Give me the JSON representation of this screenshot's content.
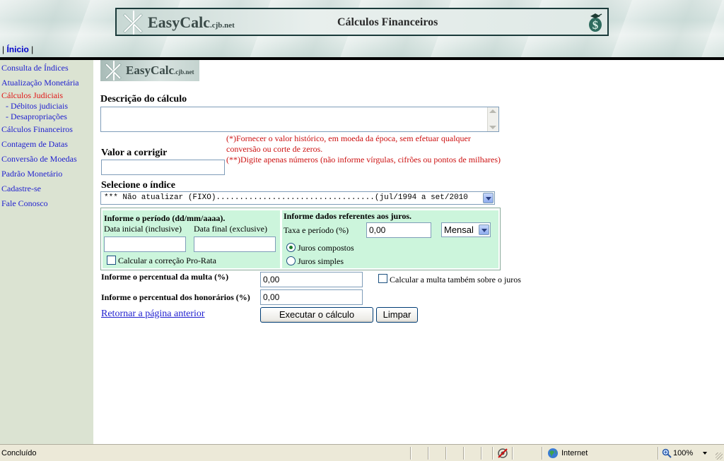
{
  "header": {
    "logo_main": "EasyCalc",
    "logo_domain": ".cjb.net",
    "title": "Cálculos Financeiros",
    "nav_open": "|",
    "nav_home": "Ínicio",
    "nav_close": "|"
  },
  "sidebar": {
    "items": [
      {
        "label": "Consulta de Índices",
        "active": false
      },
      {
        "label": "Atualização Monetária",
        "active": false
      },
      {
        "label": "Cálculos Judiciais",
        "active": true
      },
      {
        "label": "- Débitos judiciais",
        "active": false
      },
      {
        "label": "- Desapropriações",
        "active": false
      },
      {
        "label": "Cálculos Financeiros",
        "active": false
      },
      {
        "label": "Contagem de Datas",
        "active": false
      },
      {
        "label": "Conversão de Moedas",
        "active": false
      },
      {
        "label": "Padrão Monetário",
        "active": false
      },
      {
        "label": "Cadastre-se",
        "active": false
      },
      {
        "label": "Fale Conosco",
        "active": false
      }
    ]
  },
  "form": {
    "description_label": "Descrição do cálculo",
    "description_value": "",
    "value_label": "Valor a corrigir",
    "value_value": "",
    "note_1": "(*)Fornecer o valor histórico, em moeda da época, sem efetuar qualquer conversão ou corte de zeros.",
    "note_2": "(**)Digite apenas números (não informe vírgulas, cifrões ou pontos de milhares)",
    "index_label": "Selecione o índice",
    "index_selected": "*** Não atualizar (FIXO)..................................(jul/1994 a set/2010",
    "period": {
      "title": "Informe o período  (dd/mm/aaaa).",
      "start_label": "Data inicial (inclusive)",
      "end_label": "Data final (exclusive)",
      "start_value": "",
      "end_value": "",
      "prorata_label": "Calcular a correção Pro-Rata",
      "prorata_checked": false
    },
    "interest": {
      "title": "Informe dados referentes aos juros.",
      "rate_label": "Taxa e período  (%)",
      "rate_value": "0,00",
      "period_selected": "Mensal",
      "compound_label": "Juros compostos",
      "simple_label": "Juros simples",
      "selected": "compound"
    },
    "fine_label": "Informe o percentual da multa (%)",
    "fine_value": "0,00",
    "fine_on_interest_label": "Calcular a multa também sobre o juros",
    "fine_on_interest_checked": false,
    "fees_label": "Informe o percentual dos honorários (%)",
    "fees_value": "0,00",
    "back_link": "Retornar a página anterior",
    "execute_button": "Executar o cálculo",
    "clear_button": "Limpar"
  },
  "statusbar": {
    "status": "Concluído",
    "zone": "Internet",
    "zoom": "100%"
  },
  "colors": {
    "link": "#1f1fcf",
    "active_link": "#e01818",
    "note": "#cc1010",
    "panel": "#ccf5dc",
    "sidebar": "#dbe3d2"
  }
}
